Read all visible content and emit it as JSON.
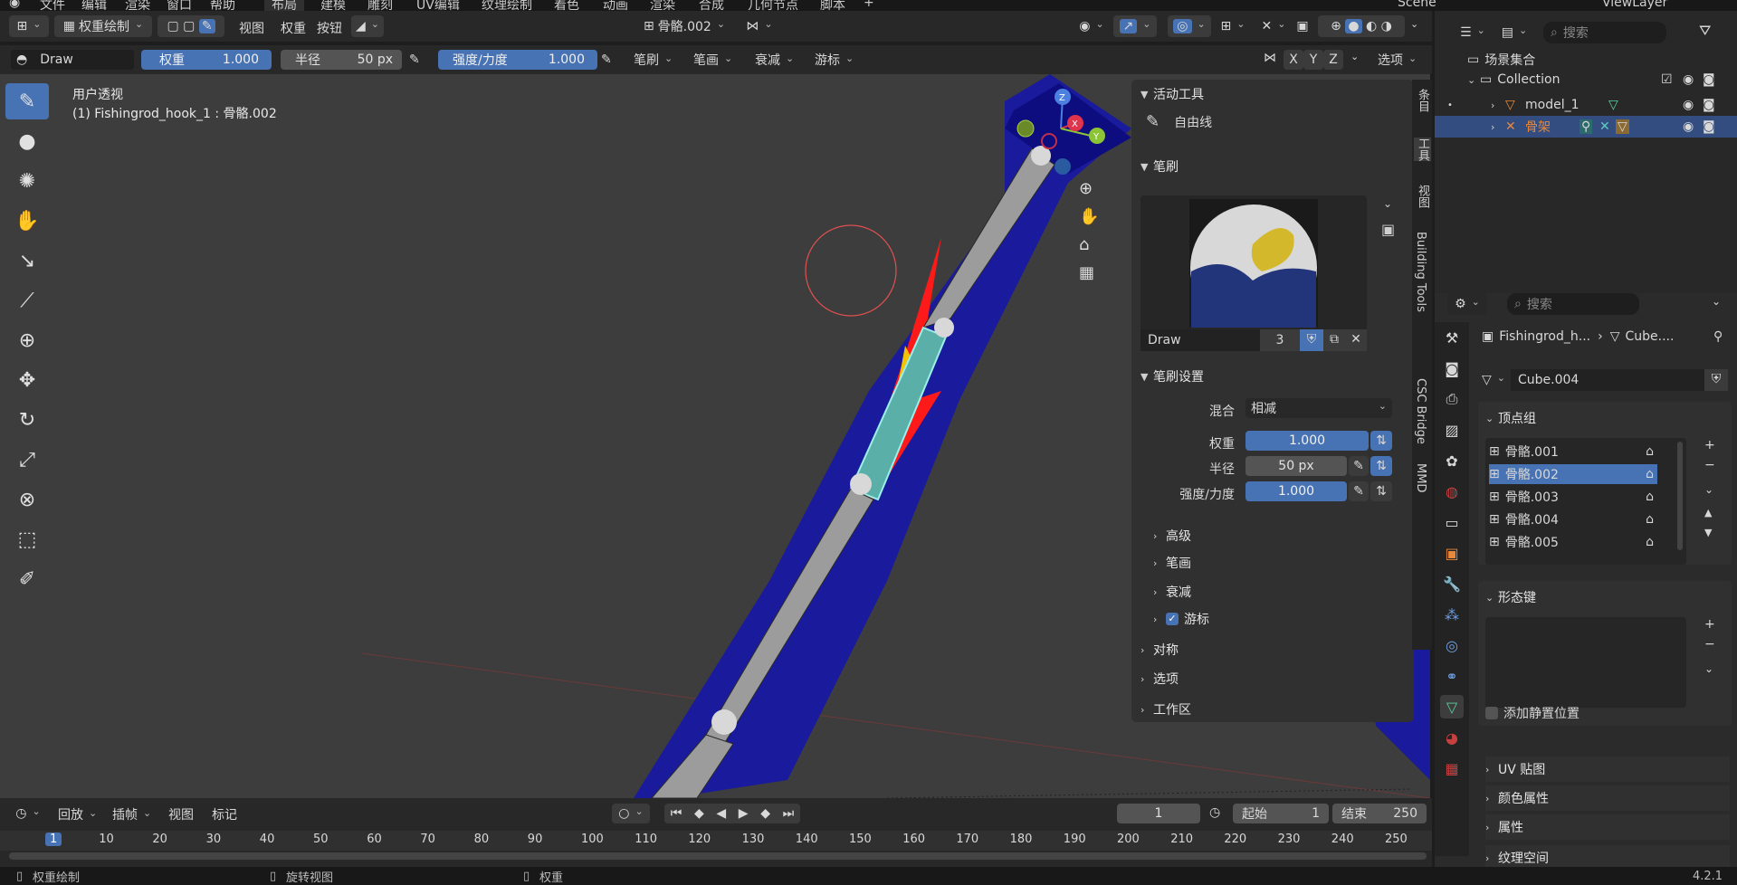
{
  "topbar": {
    "menus": [
      "文件",
      "编辑",
      "渲染",
      "窗口",
      "帮助"
    ],
    "workspaces": [
      "布局",
      "建模",
      "雕刻",
      "UV编辑",
      "纹理绘制",
      "着色",
      "动画",
      "渲染",
      "合成",
      "几何节点",
      "脚本"
    ],
    "active_workspace": "布局",
    "add_tab": "+",
    "scene": "Scene",
    "view_layer": "ViewLayer"
  },
  "viewport_header": {
    "mode": "权重绘制",
    "menus": [
      "视图",
      "权重",
      "按钮"
    ],
    "active_bone": "骨骼.002"
  },
  "tool_header": {
    "brush_name": "Draw",
    "weight_label": "权重",
    "weight_value": "1.000",
    "radius_label": "半径",
    "radius_value": "50 px",
    "strength_label": "强度/力度",
    "strength_value": "1.000",
    "dropdowns": [
      "笔刷",
      "笔画",
      "衰减",
      "游标"
    ],
    "axes": [
      "X",
      "Y",
      "Z"
    ],
    "options": "选项"
  },
  "viewport": {
    "view_name": "用户透视",
    "object_info": "(1) Fishingrod_hook_1 : 骨骼.002",
    "gizmo": {
      "z": "Z",
      "y": "Y",
      "x": "X"
    }
  },
  "npanel": {
    "active_tool_header": "活动工具",
    "active_tool_name": "自由线",
    "brush_header": "笔刷",
    "brush_name": "Draw",
    "brush_users": "3",
    "brush_settings_header": "笔刷设置",
    "blend_label": "混合",
    "blend_value": "相减",
    "weight_label": "权重",
    "weight_value": "1.000",
    "radius_label": "半径",
    "radius_value": "50 px",
    "strength_label": "强度/力度",
    "strength_value": "1.000",
    "sub_advanced": "高级",
    "sub_stroke": "笔画",
    "sub_falloff": "衰减",
    "sub_cursor": "游标",
    "symmetry": "对称",
    "options": "选项",
    "workspace": "工作区"
  },
  "vtabs": [
    "条目",
    "工具",
    "视图",
    "Building Tools",
    "CSC Bridge",
    "MMD"
  ],
  "outliner": {
    "search_placeholder": "搜索",
    "scene_collection": "场景集合",
    "collection": "Collection",
    "items": [
      "model_1",
      "骨架"
    ]
  },
  "properties": {
    "search_placeholder": "搜索",
    "breadcrumb_object": "Fishingrod_h...",
    "breadcrumb_mesh": "Cube....",
    "mesh_name": "Cube.004",
    "vertex_groups_header": "顶点组",
    "vertex_groups": [
      "骨骼.001",
      "骨骼.002",
      "骨骼.003",
      "骨骼.004",
      "骨骼.005"
    ],
    "selected_group": "骨骼.002",
    "shape_keys_header": "形态键",
    "add_rest_position": "添加静置位置",
    "uv_maps": "UV 贴图",
    "color_attributes": "颜色属性",
    "attributes": "属性",
    "texture_space": "纹理空间"
  },
  "timeline": {
    "menus": [
      "回放",
      "插帧",
      "视图",
      "标记"
    ],
    "current_frame": "1",
    "start_label": "起始",
    "start_value": "1",
    "end_label": "结束",
    "end_value": "250",
    "ticks": [
      "1",
      "10",
      "20",
      "30",
      "40",
      "50",
      "60",
      "70",
      "80",
      "90",
      "100",
      "110",
      "120",
      "130",
      "140",
      "150",
      "160",
      "170",
      "180",
      "190",
      "200",
      "210",
      "220",
      "230",
      "240",
      "250"
    ]
  },
  "statusbar": {
    "items": [
      "权重绘制",
      "旋转视图",
      "权重"
    ],
    "version": "4.2.1"
  },
  "colors": {
    "accent_blue": "#4772b3",
    "selected_row": "#4772b3",
    "bone_orange": "#e8883a",
    "mesh_blue": "#1a1a9c",
    "weight_red": "#ff1a1a"
  }
}
